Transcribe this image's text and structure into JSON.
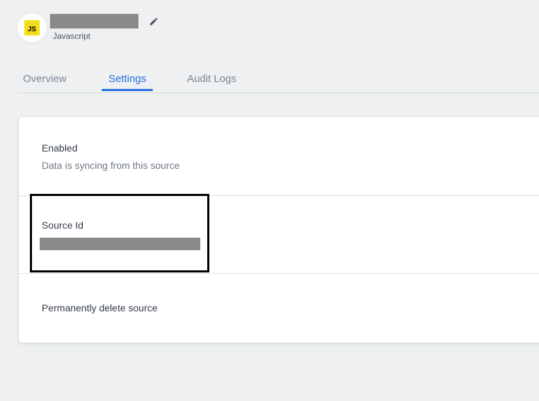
{
  "header": {
    "icon_text": "JS",
    "source_type_label": "Javascript",
    "edit_icon": "pencil-icon",
    "source_name": ""
  },
  "tabs": {
    "items": [
      {
        "label": "Overview",
        "active": false
      },
      {
        "label": "Settings",
        "active": true
      },
      {
        "label": "Audit Logs",
        "active": false
      }
    ]
  },
  "settings": {
    "enabled": {
      "title": "Enabled",
      "description": "Data is syncing from this source"
    },
    "source_id": {
      "title": "Source Id",
      "value": ""
    },
    "delete": {
      "title": "Permanently delete source"
    }
  },
  "colors": {
    "accent_blue": "#2270e0",
    "js_yellow": "#f5de19",
    "redaction_gray": "#8a8a8a",
    "highlight_black": "#000000",
    "background": "#eef0f1"
  }
}
